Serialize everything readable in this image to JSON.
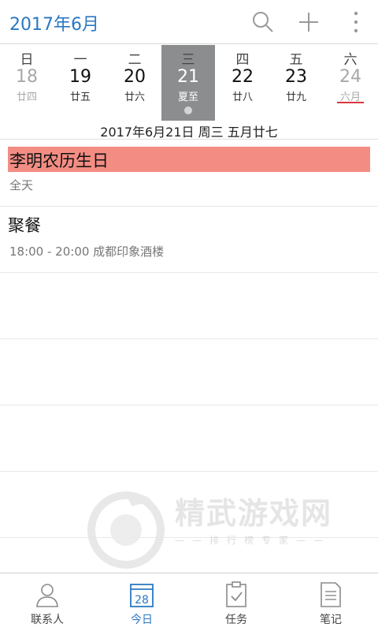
{
  "header": {
    "title": "2017年6月"
  },
  "week": [
    {
      "weekday": "日",
      "day": "18",
      "lunar": "廿四",
      "state": "dim"
    },
    {
      "weekday": "一",
      "day": "19",
      "lunar": "廿五",
      "state": "normal"
    },
    {
      "weekday": "二",
      "day": "20",
      "lunar": "廿六",
      "state": "normal"
    },
    {
      "weekday": "三",
      "day": "21",
      "lunar": "夏至",
      "state": "selected"
    },
    {
      "weekday": "四",
      "day": "22",
      "lunar": "廿八",
      "state": "normal"
    },
    {
      "weekday": "五",
      "day": "23",
      "lunar": "廿九",
      "state": "normal"
    },
    {
      "weekday": "六",
      "day": "24",
      "lunar": "六月",
      "state": "dim"
    }
  ],
  "selected_date_text": "2017年6月21日 周三 五月廿七",
  "events": [
    {
      "title": "李明农历生日",
      "subtitle": "全天",
      "highlight_color": "#f38d84"
    },
    {
      "title": "聚餐",
      "subtitle": "18:00 - 20:00  成都印象酒楼"
    }
  ],
  "watermark": {
    "brand": "精武游戏网",
    "tagline": "——排行榜专家——"
  },
  "tabs": [
    {
      "label": "联系人",
      "icon": "contact-icon"
    },
    {
      "label": "今日",
      "icon": "calendar-today-icon",
      "badge": "28"
    },
    {
      "label": "任务",
      "icon": "task-clipboard-icon"
    },
    {
      "label": "笔记",
      "icon": "note-icon"
    }
  ],
  "colors": {
    "accent": "#2b78c2",
    "selected_day_bg": "#8b8d8e",
    "holiday_underline": "#d9363e"
  }
}
